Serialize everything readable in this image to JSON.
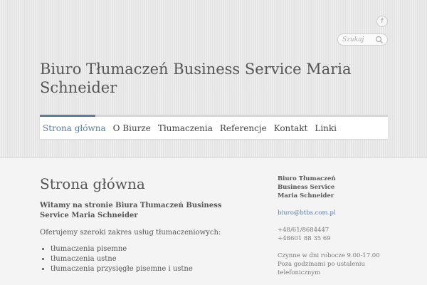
{
  "header": {
    "site_title": "Biuro Tłumaczeń Business Service Maria Schneider",
    "facebook_icon_glyph": "f",
    "search": {
      "placeholder": "Szukaj"
    }
  },
  "nav": {
    "items": [
      {
        "label": "Strona główna",
        "active": true
      },
      {
        "label": "O Biurze"
      },
      {
        "label": "Tłumaczenia"
      },
      {
        "label": "Referencje"
      },
      {
        "label": "Kontakt"
      },
      {
        "label": "Linki"
      }
    ]
  },
  "main": {
    "page_title": "Strona główna",
    "welcome": "Witamy na stronie Biura Tłumaczeń Business Service Maria Schneider",
    "offer": "Oferujemy szeroki zakres usług tłumaczeniowych:",
    "services": [
      "tłumaczenia pisemne",
      "tłumaczenia ustne",
      "tłumaczenia przysięgłe pisemne i ustne"
    ]
  },
  "sidebar": {
    "company_lines": [
      "Biuro Tłumaczeń",
      "Business Service",
      "Maria Schneider"
    ],
    "email": "biuro@btbs.com.pl",
    "phones": [
      "+48/61/8684447",
      "+48601 88 35 69"
    ],
    "hours_lines": [
      "Czynne w dni robocze 9.00-17.00",
      "Poza godzinami po ustaleniu",
      "telefonicznym"
    ]
  },
  "colors": {
    "accent": "#5b7ca3",
    "text": "#555555",
    "header_bg": "#e9e9e9",
    "page_bg": "#f4f4f4"
  }
}
